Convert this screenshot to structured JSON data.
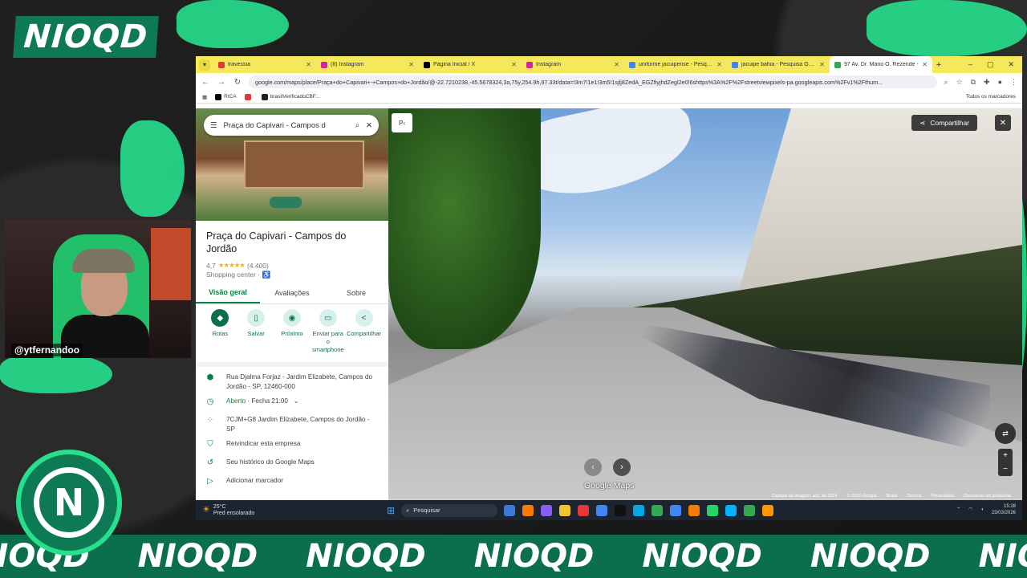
{
  "overlay": {
    "brand": "NIOQD",
    "band_words": [
      "NIOQD",
      "NIOQD",
      "NIOQD",
      "NIOQD",
      "NIOQD",
      "NIOQD",
      "NIOQD"
    ],
    "webcam_handle": "@ytfernandoo",
    "badge": "N"
  },
  "browser": {
    "tabs": [
      {
        "label": "travessia",
        "color": "#e53935"
      },
      {
        "label": "(8) Instagram",
        "color": "#d6249f"
      },
      {
        "label": "Página Inicial / X",
        "color": "#000000"
      },
      {
        "label": "Instagram",
        "color": "#d6249f"
      },
      {
        "label": "uniforme jacuipense - Pesquisa",
        "color": "#4285f4"
      },
      {
        "label": "jacuipe bahia - Pesquisa Google",
        "color": "#4285f4"
      },
      {
        "label": "97 Av. Dr. Mário O. Rezende - ",
        "color": "#34a853"
      }
    ],
    "new_tab": "+",
    "url": "google.com/maps/place/Praça+do+Capivari+-+Campos+do+Jordão/@-22.7210238,-45.5678324,3a,75y,254.9h,97.33t/data=!3m7!1e1!3m5!1sjlj8ZedA_EGZfiyjhdZegl2e0!6shttps%3A%2F%2Fstreetviewpixels-pa.googleapis.com%2Fv1%2Fthum...",
    "bookmarks": [
      {
        "label": "RICA",
        "color": "#000000"
      },
      {
        "label": "",
        "color": "#e53935"
      },
      {
        "label": "brasilVerificadoCBF...",
        "color": "#222222"
      }
    ],
    "bookmarks_right": "Todos os marcadores"
  },
  "panel": {
    "search_value": "Praça do Capivari - Campos d",
    "place_name": "Praça do Capivari - Campos do Jordão",
    "rating": "4,7",
    "stars": "★★★★★",
    "reviews": "(4.400)",
    "category": "Shopping center · ♿",
    "tabs": [
      "Visão geral",
      "Avaliações",
      "Sobre"
    ],
    "actions": [
      {
        "label": "Rotas",
        "icon": "◆"
      },
      {
        "label": "Salvar",
        "icon": "▯"
      },
      {
        "label": "Próximo",
        "icon": "◉"
      },
      {
        "label": "Enviar para o smartphone",
        "icon": "▭"
      },
      {
        "label": "Compartilhar",
        "icon": "<"
      }
    ],
    "address": "Rua Djalma Forjaz - Jardim Elizabete, Campos do Jordão - SP, 12460-000",
    "hours_status": "Aberto",
    "hours_rest": " · Fecha 21:00",
    "plus_code": "7CJM+G8 Jardim Elizabete, Campos do Jordão - SP",
    "claim": "Reivindicar esta empresa",
    "history": "Seu histórico do Google Maps",
    "add_label": "Adicionar marcador"
  },
  "streetview": {
    "places_btn": "P‹",
    "share": "Compartilhar",
    "logo": "Google Maps",
    "footer": [
      "Captura da imagem: abr. de 2024",
      "© 2026 Google",
      "Brasil",
      "Termos",
      "Privacidade",
      "Denunciar um problema"
    ]
  },
  "taskbar": {
    "temp": "25°C",
    "weather": "Pred ensolarado",
    "search_placeholder": "Pesquisar",
    "time": "15:28",
    "date": "23/03/2026",
    "app_colors": [
      "#3a7bd5",
      "#ff7a00",
      "#8b5cf6",
      "#f4c430",
      "#e53935",
      "#4285f4",
      "#111111",
      "#00a8e8",
      "#34a853",
      "#4285f4",
      "#f57c00",
      "#25d366",
      "#00b2ff",
      "#34a853",
      "#ff9800"
    ]
  }
}
